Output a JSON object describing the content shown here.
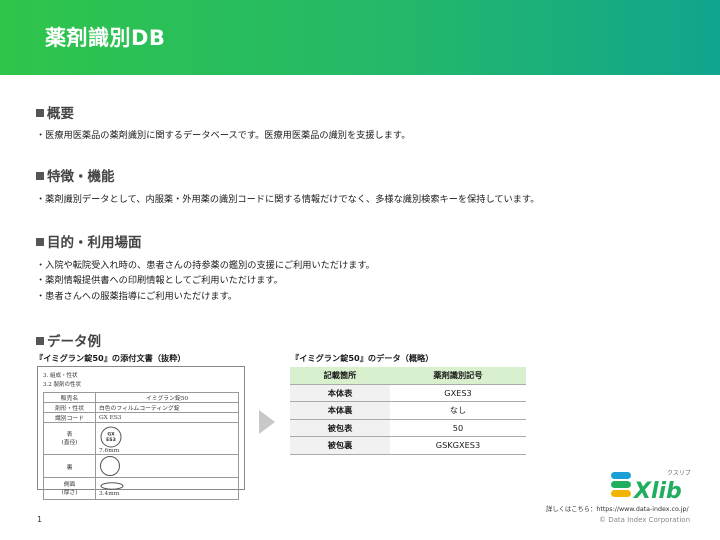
{
  "header": {
    "title": "薬剤識別DB"
  },
  "sections": {
    "overview": {
      "title": "概要",
      "lines": [
        "・医療用医薬品の薬剤識別に関するデータベースです。医療用医薬品の識別を支援します。"
      ]
    },
    "features": {
      "title": "特徴・機能",
      "lines": [
        "・薬剤識別データとして、内服薬・外用薬の識別コードに関する情報だけでなく、多様な識別検索キーを保持しています。"
      ]
    },
    "purpose": {
      "title": "目的・利用場面",
      "lines": [
        "・入院や転院受入れ時の、患者さんの持参薬の鑑別の支援にご利用いただけます。",
        "・薬剤情報提供書への印刷情報としてご利用いただけます。",
        "・患者さんへの服薬指導にご利用いただけます。"
      ]
    },
    "example": {
      "title": "データ例"
    }
  },
  "example": {
    "insert_heading": "『イミグラン錠50』の添付文書（抜粋）",
    "data_heading": "『イミグラン錠50』のデータ（概略）",
    "insert": {
      "line1": "3. 組成・性状",
      "line2": "3.2 製剤の性状",
      "rows": [
        {
          "label": "販売名",
          "value": "イミグラン錠50"
        },
        {
          "label": "剤形・性状",
          "value": "白色のフィルムコーティング錠"
        },
        {
          "label": "識別コード",
          "value": "GX ES3"
        },
        {
          "label": "表\n(直径)",
          "value": "7.6mm",
          "imprint_line1": "GX",
          "imprint_line2": "ES3"
        },
        {
          "label": "裏",
          "value": ""
        },
        {
          "label": "側面\n(厚さ)",
          "value": "3.4mm"
        }
      ]
    },
    "table": {
      "headers": [
        "記載箇所",
        "薬剤識別記号"
      ],
      "rows": [
        [
          "本体表",
          "GXES3"
        ],
        [
          "本体裏",
          "なし"
        ],
        [
          "被包表",
          "50"
        ],
        [
          "被包裏",
          "GSKGXES3"
        ]
      ]
    }
  },
  "logo": {
    "text": "Xlib",
    "kana": "クスリブ",
    "brand_color": "#1fae5e",
    "accent_color": "#1b9fd6"
  },
  "footer": {
    "link": "詳しくはこちら：https://www.data-index.co.jp/",
    "copyright": "© Data Index Corporation",
    "page": "1"
  }
}
